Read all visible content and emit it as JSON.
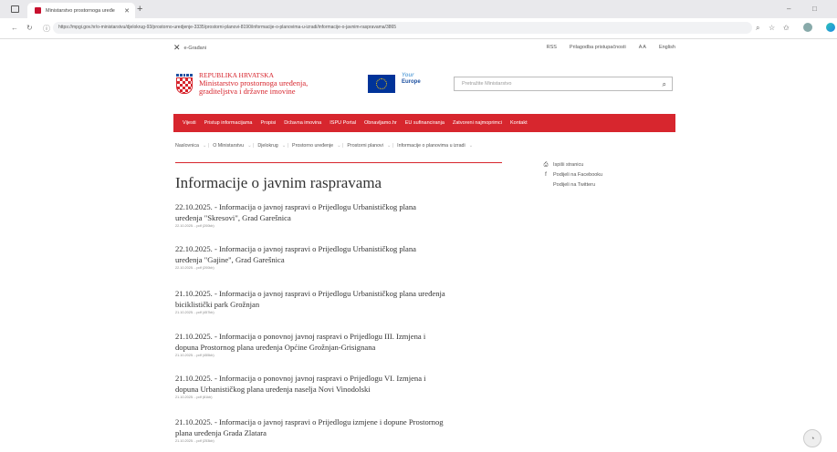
{
  "browser": {
    "tab_title": "Ministarstvo prostornoga uređe",
    "url": "https://mpgi.gov.hr/o-ministarstvu/djelokrug-93/prostorno-uredjenje-3335/prostorni-planovi-8190/informacije-o-planovima-u-izradi/informacije-o-javnim-raspravama/3865"
  },
  "util": {
    "egradjani": "e-Građani",
    "rss": "RSS",
    "accessibility": "Prilagodba pristupačnosti",
    "font_toggle": "A A",
    "english": "English"
  },
  "header": {
    "line1": "REPUBLIKA HRVATSKA",
    "line2": "Ministarstvo prostornoga uređenja,",
    "line3": "graditeljstva i državne imovine",
    "ye1": "Your",
    "ye2": "Europe",
    "search_placeholder": "Pretražite Ministarstvo"
  },
  "nav": [
    "Vijesti",
    "Pristup informacijama",
    "Propisi",
    "Državna imovina",
    "ISPU Portal",
    "Obnavljamo.hr",
    "EU sufinanciranja",
    "Zatvoreni najmoprimci",
    "Kontakt"
  ],
  "breadcrumb": [
    "Naslovnica",
    "O Ministarstvu",
    "Djelokrug",
    "Prostorno uređenje",
    "Prostorni planovi",
    "Informacije o planovima u izradi"
  ],
  "page_title": "Informacije o javnim raspravama",
  "share": {
    "print": "Ispiši stranicu",
    "facebook": "Podijeli na Facebooku",
    "twitter": "Podijeli na Twitteru"
  },
  "items": [
    {
      "line1": "22.10.2025. - Informacija o javnoj raspravi o Prijedlogu Urbanističkog plana",
      "line2": "uređenja \"Skresovi\", Grad Garešnica",
      "meta": "22.10.2025. - pdf (200kb)"
    },
    {
      "line1": "22.10.2025. - Informacija o javnoj raspravi o Prijedlogu Urbanističkog plana",
      "line2": "uređenja \"Gajine\", Grad Garešnica",
      "meta": "22.10.2025. - pdf (200kb)"
    },
    {
      "line1": "21.10.2025. - Informacija o javnoj raspravi o Prijedlogu Urbanističkog plana uređenja",
      "line2": "biciklistički park Grožnjan",
      "meta": "21.10.2025. - pdf (457kb)"
    },
    {
      "line1": "21.10.2025. - Informacija o ponovnoj javnoj raspravi o Prijedlogu III. Izmjena i",
      "line2": "dopuna Prostornog plana uređenja Općine Grožnjan-Grisignana",
      "meta": "21.10.2025. - pdf (455kb)"
    },
    {
      "line1": "21.10.2025. - Informacija o ponovnoj javnoj raspravi o Prijedlogu VI. Izmjena i",
      "line2": "dopuna Urbanističkog plana uređenja naselja Novi Vinodolski",
      "meta": "21.10.2025. - pdf (81kb)"
    },
    {
      "line1": "21.10.2025. - Informacija o javnoj raspravi o Prijedlogu izmjene i dopune Prostornog",
      "line2": "plana uređenja Grada Zlatara",
      "meta": "21.10.2025. - pdf (253kb)"
    }
  ]
}
